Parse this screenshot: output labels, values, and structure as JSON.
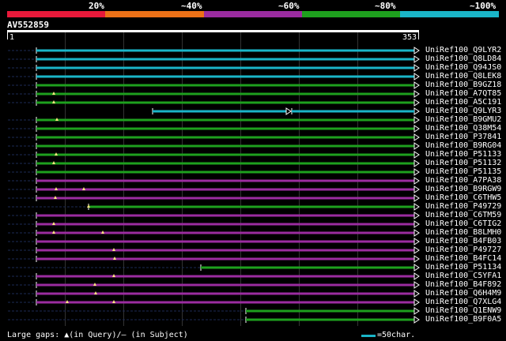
{
  "header": {
    "percent_labels": [
      "20%",
      "~40%",
      "~60%",
      "~80%",
      "~100%"
    ],
    "legend_colors": [
      "#e8193a",
      "#ec7117",
      "#9b2ca0",
      "#1ea01e",
      "#1ab5c8"
    ],
    "query_id": "AV552859",
    "ruler_start": "1",
    "ruler_end": "353"
  },
  "hits": [
    {
      "label": "UniRef100_Q9LYR2",
      "color": "#1ab5c8"
    },
    {
      "label": "UniRef100_Q8LD84",
      "color": "#1ab5c8"
    },
    {
      "label": "UniRef100_Q94JS0",
      "color": "#1ab5c8"
    },
    {
      "label": "UniRef100_Q8LEK8",
      "color": "#1ab5c8"
    },
    {
      "label": "UniRef100_B9GZ18",
      "color": "#1ea01e"
    },
    {
      "label": "UniRef100_A7QT85",
      "color": "#1ea01e"
    },
    {
      "label": "UniRef100_A5C191",
      "color": "#1ea01e"
    },
    {
      "label": "UniRef100_Q9LYR3",
      "color": "#1ab5c8"
    },
    {
      "label": "UniRef100_B9GMU2",
      "color": "#1ea01e"
    },
    {
      "label": "UniRef100_Q38M54",
      "color": "#1ea01e"
    },
    {
      "label": "UniRef100_P37841",
      "color": "#1ea01e"
    },
    {
      "label": "UniRef100_B9RG04",
      "color": "#1ea01e"
    },
    {
      "label": "UniRef100_P51133",
      "color": "#1ea01e"
    },
    {
      "label": "UniRef100_P51132",
      "color": "#1ea01e"
    },
    {
      "label": "UniRef100_P51135",
      "color": "#1ea01e"
    },
    {
      "label": "UniRef100_A7PA38",
      "color": "#9b2ca0"
    },
    {
      "label": "UniRef100_B9RGW9",
      "color": "#9b2ca0"
    },
    {
      "label": "UniRef100_C6THW5",
      "color": "#9b2ca0"
    },
    {
      "label": "UniRef100_P49729",
      "color": "#1ea01e"
    },
    {
      "label": "UniRef100_C6TM59",
      "color": "#9b2ca0"
    },
    {
      "label": "UniRef100_C6TIG2",
      "color": "#9b2ca0"
    },
    {
      "label": "UniRef100_B8LMH0",
      "color": "#9b2ca0"
    },
    {
      "label": "UniRef100_B4FB03",
      "color": "#9b2ca0"
    },
    {
      "label": "UniRef100_P49727",
      "color": "#9b2ca0"
    },
    {
      "label": "UniRef100_B4FC14",
      "color": "#9b2ca0"
    },
    {
      "label": "UniRef100_P51134",
      "color": "#1ea01e"
    },
    {
      "label": "UniRef100_C5YFA1",
      "color": "#9b2ca0"
    },
    {
      "label": "UniRef100_B4F892",
      "color": "#9b2ca0"
    },
    {
      "label": "UniRef100_Q6H4M9",
      "color": "#9b2ca0"
    },
    {
      "label": "UniRef100_Q7XLG4",
      "color": "#9b2ca0"
    },
    {
      "label": "UniRef100_Q1ENW9",
      "color": "#1ea01e"
    },
    {
      "label": "UniRef100_B9F0A5",
      "color": "#1ea01e"
    }
  ],
  "footer": {
    "text": "Large gaps: ▲(in Query)/— (in Subject)",
    "scale_label": "=50char.",
    "scale_color": "#1ab5c8"
  }
}
